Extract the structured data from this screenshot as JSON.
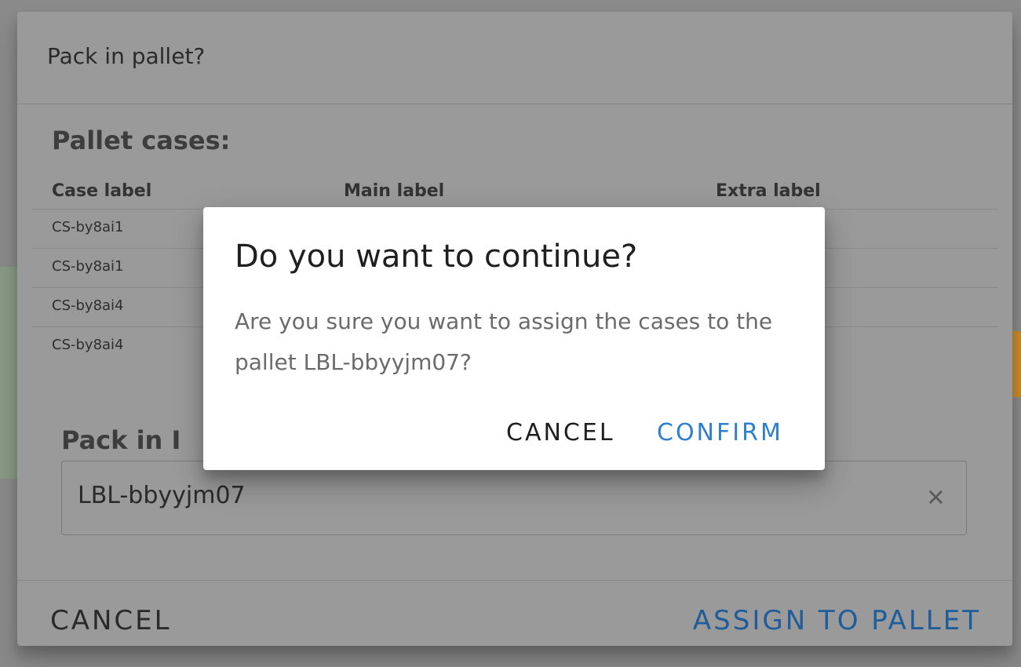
{
  "main_dialog": {
    "title": "Pack in pallet?",
    "section_heading": "Pallet cases:",
    "table": {
      "headers": [
        "Case label",
        "Main label",
        "Extra label"
      ],
      "rows": [
        {
          "case_label": "CS-by8ai1"
        },
        {
          "case_label": "CS-by8ai1"
        },
        {
          "case_label": "CS-by8ai4"
        },
        {
          "case_label": "CS-by8ai4"
        }
      ]
    },
    "pack_heading": "Pack in I",
    "pallet_value": "LBL-bbyyjm07",
    "clear_symbol": "×",
    "cancel_label": "CANCEL",
    "assign_label": "ASSIGN TO PALLET"
  },
  "confirm_dialog": {
    "title": "Do you want to continue?",
    "message": "Are you sure you want to assign the cases to the pallet LBL-bbyyjm07?",
    "cancel_label": "CANCEL",
    "confirm_label": "CONFIRM"
  },
  "colors": {
    "accent_blue": "#2f7fcf",
    "backdrop": "#8a8a8a"
  }
}
